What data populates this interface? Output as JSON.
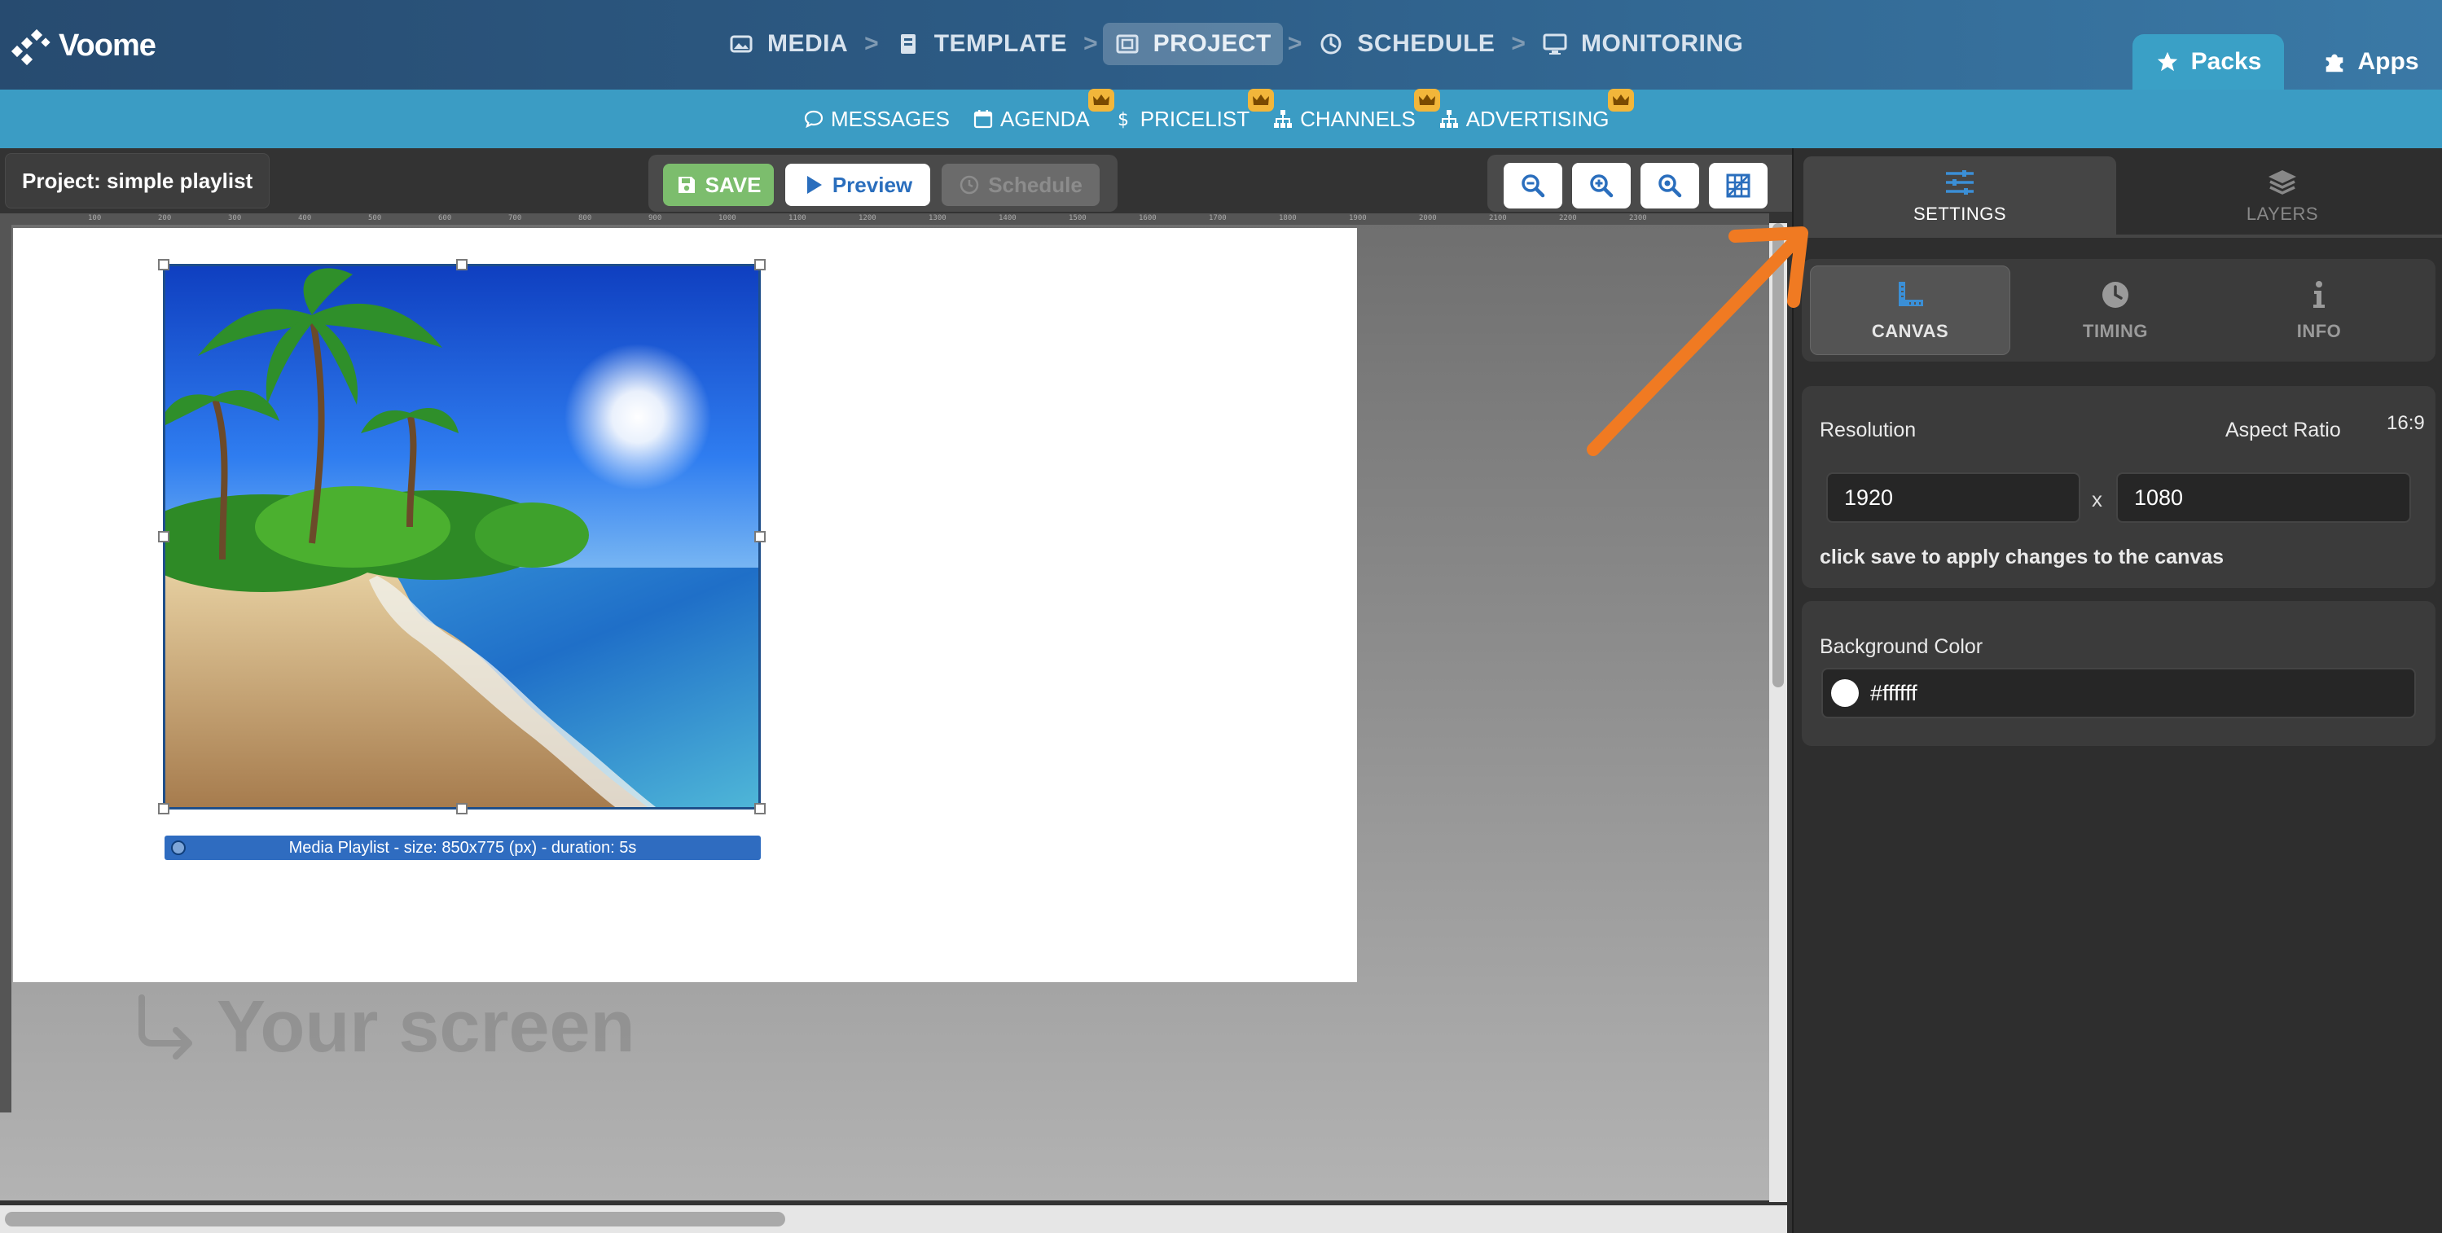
{
  "app": {
    "logo_text": "Voome"
  },
  "nav": {
    "items": [
      {
        "label": "MEDIA",
        "icon": "image-icon"
      },
      {
        "label": "TEMPLATE",
        "icon": "book-icon"
      },
      {
        "label": "PROJECT",
        "icon": "project-icon",
        "active": true
      },
      {
        "label": "SCHEDULE",
        "icon": "clock-icon"
      },
      {
        "label": "MONITORING",
        "icon": "monitor-icon"
      }
    ],
    "separator": ">"
  },
  "right_tabs": {
    "packs": "Packs",
    "apps": "Apps"
  },
  "sub_nav": {
    "messages": "MESSAGES",
    "agenda": "AGENDA",
    "pricelist": "PRICELIST",
    "channels": "CHANNELS",
    "advertising": "ADVERTISING"
  },
  "toolbar": {
    "project_title": "Project: simple playlist",
    "save": "SAVE",
    "preview": "Preview",
    "schedule": "Schedule"
  },
  "ruler_ticks": [
    "100",
    "200",
    "300",
    "400",
    "500",
    "600",
    "700",
    "800",
    "900",
    "1000",
    "1100",
    "1200",
    "1300",
    "1400",
    "1500",
    "1600",
    "1700",
    "1800",
    "1900",
    "2000",
    "2100",
    "2200",
    "2300"
  ],
  "canvas": {
    "media_label": "Media Playlist - size: 850x775 (px) - duration: 5s",
    "your_screen": "Your screen"
  },
  "panel": {
    "tabs": {
      "settings": "SETTINGS",
      "layers": "LAYERS"
    },
    "sub_tabs": {
      "canvas": "CANVAS",
      "timing": "TIMING",
      "info": "INFO"
    },
    "resolution": {
      "label": "Resolution",
      "aspect_label": "Aspect Ratio",
      "aspect_value": "16:9",
      "width": "1920",
      "height": "1080",
      "separator": "x",
      "hint": "click save to apply changes to the canvas"
    },
    "background": {
      "label": "Background Color",
      "value": "#ffffff"
    }
  },
  "colors": {
    "accent_blue": "#3b9cc4",
    "save_green": "#7cbd6d",
    "annotation_arrow": "#f07a22",
    "premium_crown": "#f2b63a"
  }
}
